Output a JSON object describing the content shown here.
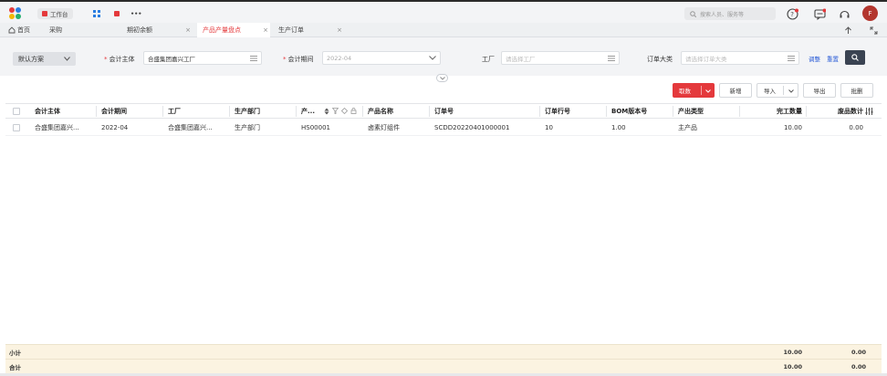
{
  "topbar": {
    "workbench_label": "工作台",
    "more_label": "•••",
    "search_placeholder": "搜索人员、服务等",
    "avatar_initial": "F"
  },
  "tabs": [
    {
      "label": "首页"
    },
    {
      "label": "采购"
    },
    {
      "label": "期初余额",
      "close": "×"
    },
    {
      "label": "产品产量盘点",
      "close": "×"
    },
    {
      "label": "生产订单",
      "close": "×"
    }
  ],
  "filters": {
    "scheme": "默认方案",
    "accounting_entity_label": "会计主体",
    "accounting_entity_value": "合盛集团嘉兴工厂",
    "accounting_period_label": "会计期间",
    "accounting_period_value": "2022-04",
    "factory_label": "工厂",
    "factory_placeholder": "请选择工厂",
    "order_category_label": "订单大类",
    "order_category_placeholder": "请选择订单大类",
    "adjust_label": "调整",
    "reset_label": "重置"
  },
  "toolbar": {
    "fetch_label": "取数",
    "add_label": "新增",
    "import_label": "导入",
    "export_label": "导出",
    "batch_label": "批删"
  },
  "table": {
    "columns": [
      "会计主体",
      "会计期间",
      "工厂",
      "生产部门",
      "产...",
      "产品名称",
      "订单号",
      "订单行号",
      "BOM版本号",
      "产出类型",
      "完工数量",
      "废品数计"
    ],
    "rows": [
      [
        "合盛集团嘉兴...",
        "2022-04",
        "合盛集团嘉兴...",
        "生产部门",
        "HS00001",
        "卤素灯组件",
        "SCDD20220401000001",
        "10",
        "1.00",
        "主产品",
        "10.00",
        "0.00"
      ]
    ],
    "subtotal_label": "小计",
    "subtotal_completed": "10.00",
    "subtotal_scrap": "0.00",
    "total_label": "合计",
    "total_completed": "10.00",
    "total_scrap": "0.00"
  },
  "colors": {
    "accent": "#e4393c",
    "link": "#2a5bd7",
    "summary_bg": "#fbf3e1"
  }
}
